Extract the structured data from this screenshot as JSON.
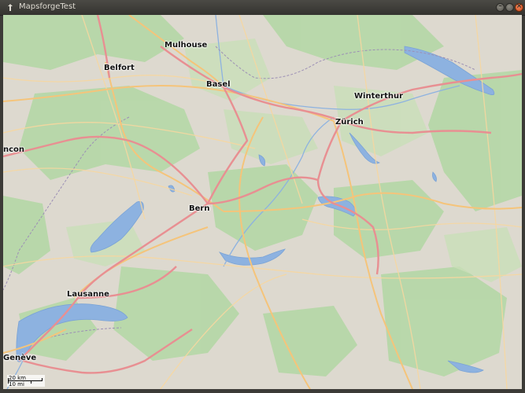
{
  "window": {
    "title": "MapsforgeTest",
    "buttons": {
      "minimize": "–",
      "maximize": "",
      "close": "×"
    }
  },
  "map": {
    "cities": {
      "mulhouse": "Mulhouse",
      "belfort": "Belfort",
      "basel": "Basel",
      "winterthur": "Winterthur",
      "zurich": "Zürich",
      "besancon": "ncon",
      "bern": "Bern",
      "lausanne": "Lausanne",
      "geneve": "Genève"
    },
    "scale": {
      "metric": "20 km",
      "imperial": "10 mi"
    }
  },
  "colors": {
    "land": "#ddd9cf",
    "forest": "#add19e",
    "water": "#8db2e0",
    "motorway": "#e88f92",
    "primary": "#f5c47a",
    "border": "#9c8fb5"
  }
}
